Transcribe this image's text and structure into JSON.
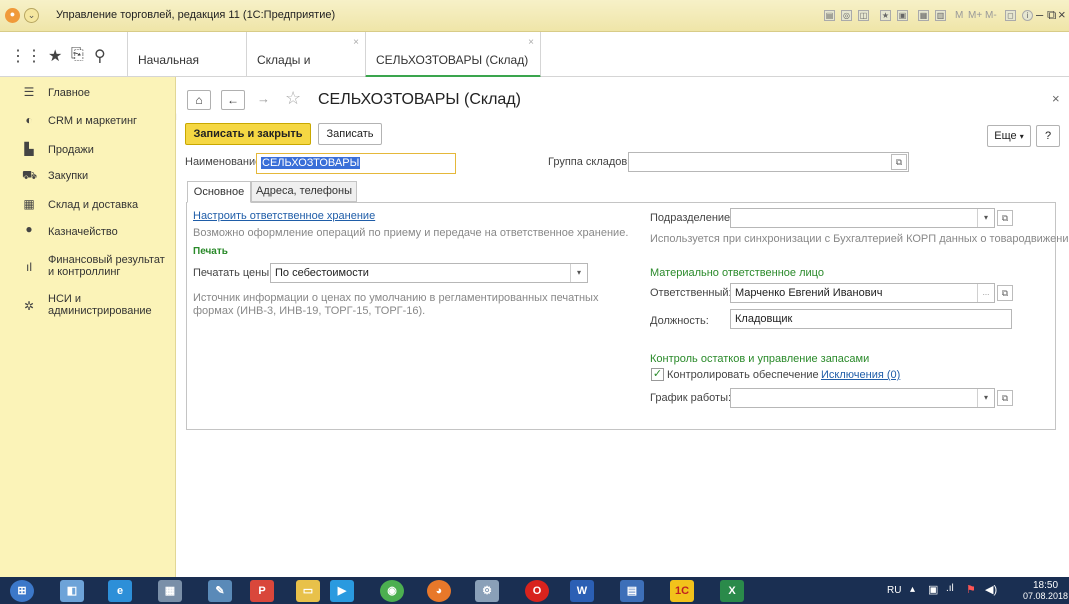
{
  "titlebar": {
    "title": "Управление торговлей, редакция 11  (1С:Предприятие)"
  },
  "tabs": [
    {
      "label": "Начальная страница"
    },
    {
      "label": "Склады и магазины"
    },
    {
      "label": "СЕЛЬХОЗТОВАРЫ (Склад)"
    }
  ],
  "sidebar": {
    "items": [
      {
        "label": "Главное",
        "icon": "menu-icon"
      },
      {
        "label": "CRM и маркетинг",
        "icon": "crm-icon"
      },
      {
        "label": "Продажи",
        "icon": "bag-icon"
      },
      {
        "label": "Закупки",
        "icon": "cart-icon"
      },
      {
        "label": "Склад и доставка",
        "icon": "warehouse-icon"
      },
      {
        "label": "Казначейство",
        "icon": "coin-icon"
      },
      {
        "label": "Финансовый результат и контроллинг",
        "icon": "chart-icon"
      },
      {
        "label": "НСИ и администрирование",
        "icon": "gear-icon"
      }
    ]
  },
  "form": {
    "title": "СЕЛЬХОЗТОВАРЫ (Склад)",
    "btn_save_close": "Записать и закрыть",
    "btn_save": "Записать",
    "btn_more": "Еще",
    "btn_help": "?",
    "name_label": "Наименование:",
    "name_value": "СЕЛЬХОЗТОВАРЫ",
    "group_label": "Группа складов:",
    "group_value": "",
    "tabs": [
      "Основное",
      "Адреса, телефоны"
    ],
    "responsible_storage_link": "Настроить ответственное хранение",
    "responsible_storage_hint": "Возможно оформление операций по приему и передаче на ответственное хранение.",
    "print_header": "Печать",
    "print_prices_label": "Печатать цены:",
    "print_prices_value": "По себестоимости",
    "print_hint": "Источник информации о ценах по умолчанию в регламентированных печатных формах (ИНВ-3, ИНВ-19, ТОРГ-15, ТОРГ-16).",
    "division_label": "Подразделение:",
    "division_value": "",
    "division_hint": "Используется при синхронизации с Бухгалтерией КОРП данных о товародвижении.",
    "mol_header": "Материально ответственное лицо",
    "responsible_label": "Ответственный:",
    "responsible_value": "Марченко Евгений Иванович",
    "position_label": "Должность:",
    "position_value": "Кладовщик",
    "stock_header": "Контроль остатков и управление запасами",
    "control_label": "Контролировать обеспечение",
    "control_checked": true,
    "exceptions_link": "Исключения (0)",
    "schedule_label": "График работы:",
    "schedule_value": ""
  },
  "taskbar": {
    "lang": "RU",
    "time": "18:50",
    "date": "07.08.2018"
  },
  "colors": {
    "accent_yellow": "#f5d743",
    "sidebar_bg": "#fbf3b8",
    "green": "#2a8a2a",
    "link": "#1f5da8"
  }
}
